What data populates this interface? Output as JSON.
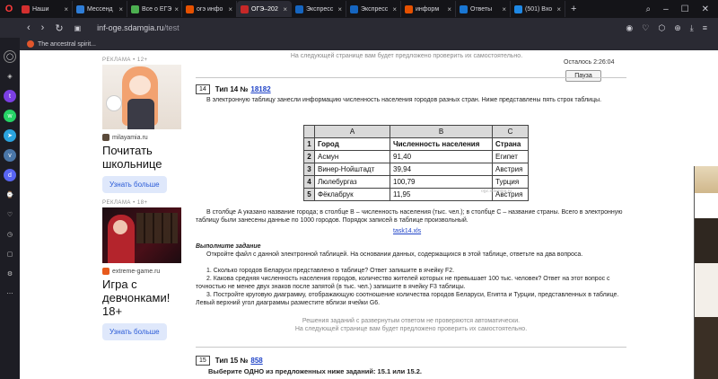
{
  "browser": {
    "tabs": [
      {
        "label": "Наши",
        "color": "#d32f2f",
        "active": false
      },
      {
        "label": "Мессенд",
        "color": "#2e7dd7",
        "active": false
      },
      {
        "label": "Все о ЕГЭ",
        "color": "#4caf50",
        "active": false
      },
      {
        "label": "огэ инфо",
        "color": "#e65100",
        "active": false
      },
      {
        "label": "ОГЭ–202",
        "color": "#c62828",
        "active": true
      },
      {
        "label": "Экспресс",
        "color": "#1565c0",
        "active": false
      },
      {
        "label": "Экспресс",
        "color": "#1565c0",
        "active": false
      },
      {
        "label": "информ",
        "color": "#e65100",
        "active": false
      },
      {
        "label": "Ответы",
        "color": "#1976d2",
        "active": false
      },
      {
        "label": "(501) Вхо",
        "color": "#1e88e5",
        "active": false
      }
    ],
    "url_host": "inf-oge.sdamgia.ru",
    "url_path": "/test",
    "bookmark": "The ancestral spirit..."
  },
  "ads": {
    "ad1": {
      "label": "РЕКЛАМА • 12+",
      "source": "milayamia.ru",
      "title": "Почитать школьнице",
      "button": "Узнать больше"
    },
    "ad2": {
      "label": "РЕКЛАМА • 18+",
      "source": "extreme-game.ru",
      "title": "Игра с девчонками! 18+",
      "button": "Узнать больше"
    }
  },
  "page": {
    "top_note": "На следующей странице вам будет предложено проверить их самостоятельно.",
    "timer": "Осталось 2:26:04",
    "pause": "Пауза",
    "task14": {
      "number": "14",
      "type_label": "Тип 14 №",
      "id": "18182",
      "intro": "В электронную таблицу занесли информацию численность населения городов разных стран. Ниже представлены пять строк таблицы.",
      "table": {
        "cols": [
          "A",
          "B",
          "C"
        ],
        "rows": [
          [
            "1",
            "Город",
            "Численность населения",
            "Страна"
          ],
          [
            "2",
            "Асмун",
            "91,40",
            "Египет"
          ],
          [
            "3",
            "Винер-Нойштадт",
            "39,94",
            "Австрия"
          ],
          [
            "4",
            "Люлебургаз",
            "100,79",
            "Турция"
          ],
          [
            "5",
            "Фёклабрук",
            "11,95",
            "Австрия"
          ]
        ]
      },
      "watermark": "ogz.sdamgia.ru",
      "desc": "В столбце A указано название города; в столбце B – численность населения (тыс. чел.); в столбце C – название страны. Всего в электронную таблицу были занесены данные по 1000 городов. Порядок записей в таблице произвольный.",
      "file": "task14.xls",
      "do_title": "Выполните задание",
      "do_intro": "Откройте файл с данной электронной таблицей. На основании данных, содержащихся в этой таблице, ответьте на два вопроса.",
      "q1": "1. Сколько городов Беларуси представлено в таблице? Ответ запишите в ячейку F2.",
      "q2": "2. Какова средняя численность населения городов, количество жителей которых не превышает 100 тыс. человек? Ответ на этот вопрос с точностью не менее двух знаков после запятой (в тыс. чел.) запишите в ячейку F3 таблицы.",
      "q3": "3. Постройте круговую диаграмму, отображающую соотношение количества городов Беларуси, Египта и Турции, представленных в таблице. Левый верхний угол диаграммы разместите вблизи ячейки G6.",
      "note1": "Решения заданий с развернутым ответом не проверяются автоматически.",
      "note2": "На следующей странице вам будет предложено проверить их самостоятельно."
    },
    "task15": {
      "number": "15",
      "type_label": "Тип 15 №",
      "id": "858",
      "instruction": "Выберите ОДНО из предложенных ниже заданий: 15.1 или 15.2."
    }
  }
}
